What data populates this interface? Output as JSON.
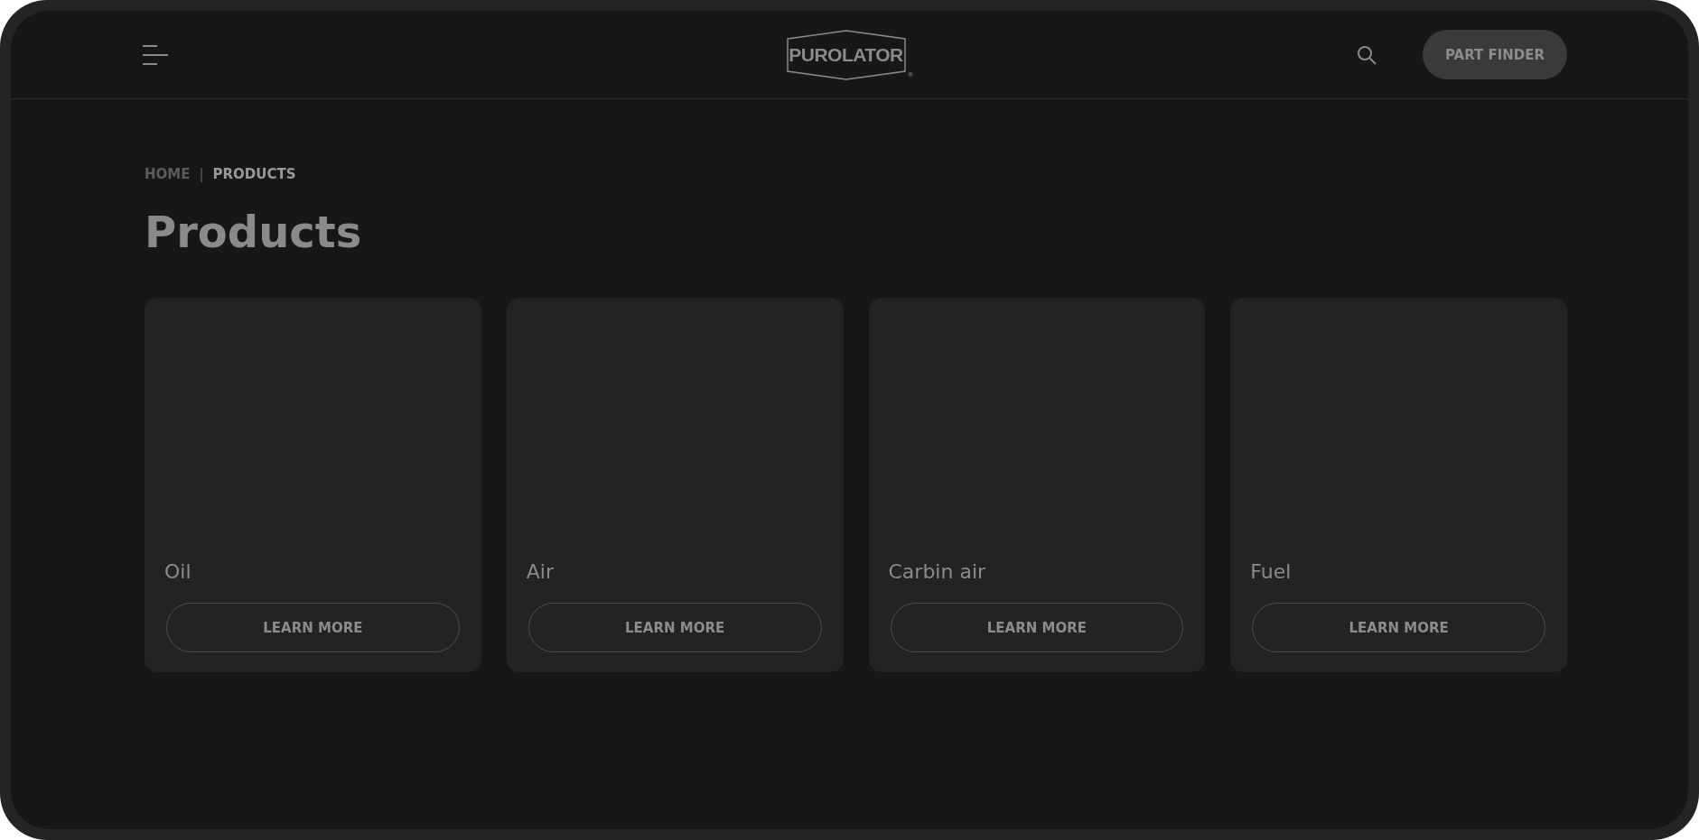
{
  "header": {
    "logo": {
      "wordmark": "PUROLATOR",
      "mark": "®"
    },
    "part_finder": "PART FINDER"
  },
  "breadcrumb": [
    {
      "label": "HOME",
      "selected": false
    },
    {
      "label": "PRODUCTS",
      "selected": true
    }
  ],
  "breadcrumb_separator": "|",
  "title": "Products",
  "cards": [
    {
      "name": "Oil",
      "button": "LEARN MORE"
    },
    {
      "name": "Air",
      "button": "LEARN MORE"
    },
    {
      "name": "Carbin air",
      "button": "LEARN MORE"
    },
    {
      "name": "Fuel",
      "button": "LEARN MORE"
    }
  ]
}
